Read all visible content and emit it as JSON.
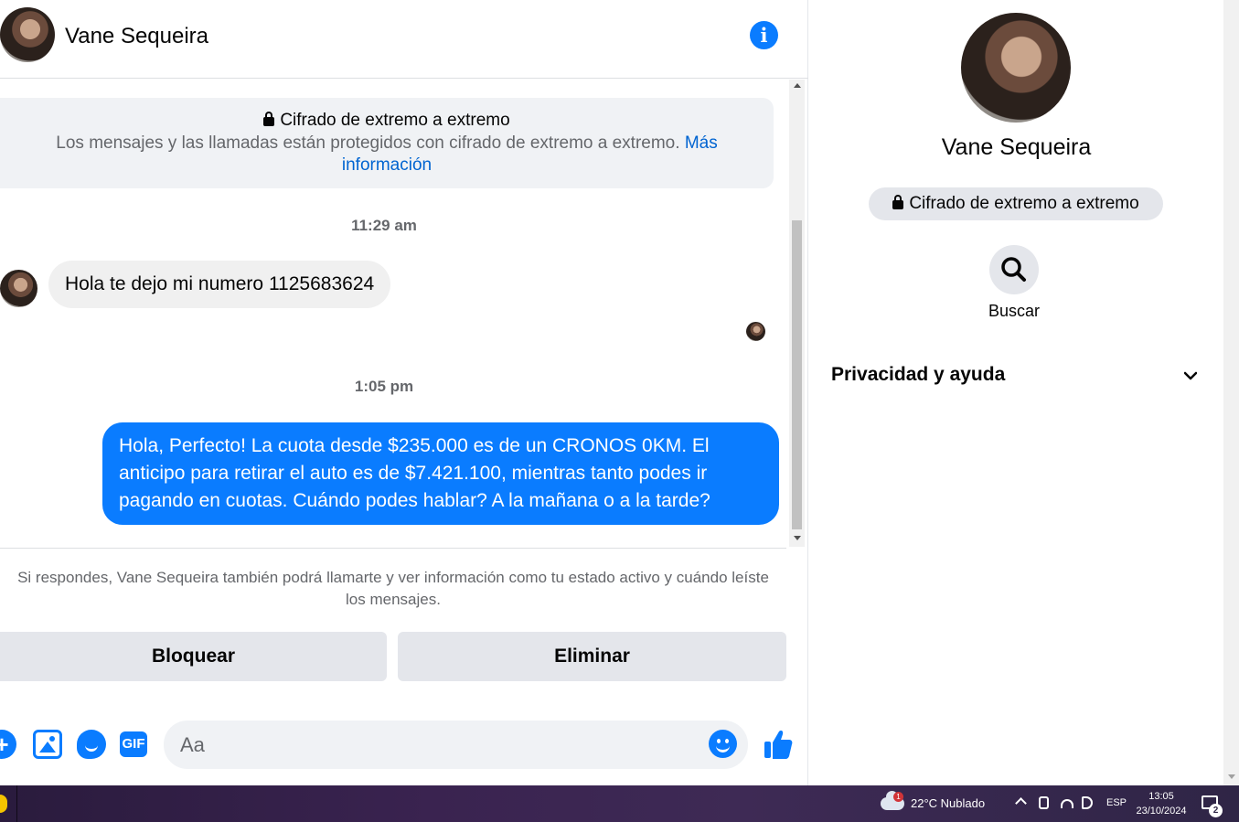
{
  "chat": {
    "contact_name": "Vane Sequeira",
    "e2ee_title": "Cifrado de extremo a extremo",
    "e2ee_text": "Los mensajes y las llamadas están protegidos con cifrado de extremo a extremo.",
    "e2ee_link": "Más información",
    "messages": [
      {
        "timestamp": "11:29 am",
        "direction": "incoming",
        "text": "Hola te dejo mi numero 1125683624"
      },
      {
        "timestamp": "1:05 pm",
        "direction": "outgoing",
        "text": "Hola, Perfecto! La cuota desde $235.000 es de un CRONOS 0KM. El anticipo para retirar el auto es de $7.421.100, mientras tanto podes ir pagando en cuotas. Cuándo podes hablar? A la mañana o a la tarde?"
      }
    ],
    "notice": "Si respondes, Vane Sequeira también podrá llamarte y ver información como tu estado activo y cuándo leíste los mensajes.",
    "block_label": "Bloquear",
    "delete_label": "Eliminar",
    "composer": {
      "placeholder": "Aa",
      "gif_label": "GIF",
      "plus_label": "+"
    }
  },
  "profile": {
    "name": "Vane Sequeira",
    "e2ee_pill": "Cifrado de extremo a extremo",
    "search_label": "Buscar",
    "privacy_label": "Privacidad y ayuda"
  },
  "taskbar": {
    "weather": "22°C  Nublado",
    "weather_badge": "1",
    "language": "ESP",
    "time": "13:05",
    "date": "23/10/2024",
    "notifications": "2"
  },
  "colors": {
    "accent": "#0a7cff",
    "link": "#0064d1",
    "muted_text": "#65676b",
    "button_bg": "#e4e6eb"
  }
}
